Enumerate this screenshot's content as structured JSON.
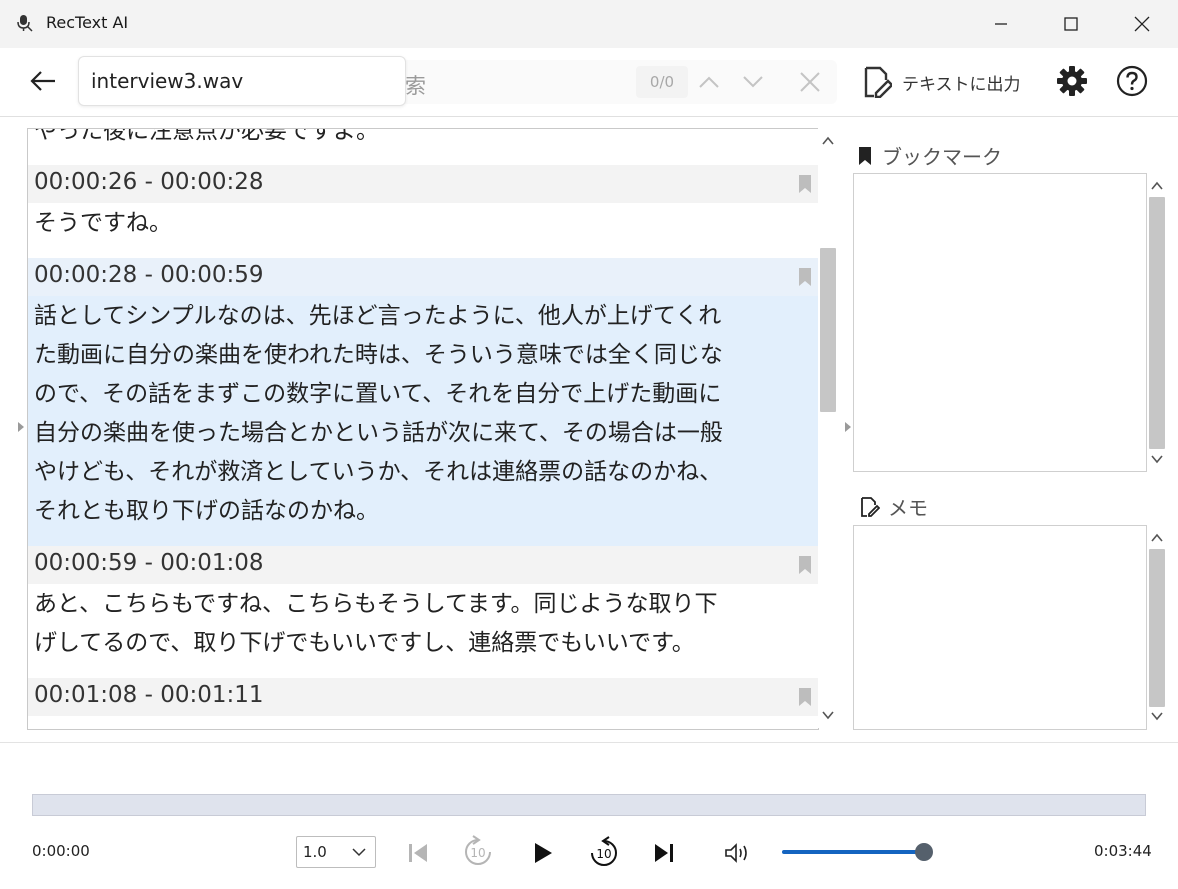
{
  "window": {
    "title": "RecText AI",
    "minimize_icon": "minimize-icon",
    "maximize_icon": "maximize-icon",
    "close_icon": "close-icon"
  },
  "toolbar": {
    "back_icon": "arrow-left-icon",
    "file_name": "interview3.wav",
    "search_placeholder": "索",
    "search_counter": "0/0",
    "export_label": "テキストに出力",
    "settings_icon": "gear-icon",
    "help_icon": "question-icon"
  },
  "transcript": {
    "partial_top": "やった後に注意点が必要ですよ。",
    "segments": [
      {
        "time": "00:00:26 - 00:00:28",
        "lines": [
          "そうですね。"
        ],
        "selected": false
      },
      {
        "time": "00:00:28 - 00:00:59",
        "lines": [
          "話としてシンプルなのは、先ほど言ったように、他人が上げてくれ",
          "た動画に自分の楽曲を使われた時は、そういう意味では全く同じな",
          "ので、その話をまずこの数字に置いて、それを自分で上げた動画に",
          "自分の楽曲を使った場合とかという話が次に来て、その場合は一般",
          "やけども、それが救済としていうか、それは連絡票の話なのかね、",
          "それとも取り下げの話なのかね。"
        ],
        "selected": true
      },
      {
        "time": "00:00:59 - 00:01:08",
        "lines": [
          "あと、こちらもですね、こちらもそうしてます。同じような取り下",
          "げしてるので、取り下げでもいいですし、連絡票でもいいです。"
        ],
        "selected": false
      },
      {
        "time": "00:01:08 - 00:01:11",
        "lines": [],
        "selected": false
      }
    ]
  },
  "right_panel": {
    "bookmark_title": "ブックマーク",
    "memo_title": "メモ"
  },
  "player": {
    "time_current": "0:00:00",
    "time_total": "0:03:44",
    "speed": "1.0",
    "volume_level": 0.95,
    "colors": {
      "accent": "#1464c0",
      "progress_bg": "#dfe3ed"
    }
  }
}
